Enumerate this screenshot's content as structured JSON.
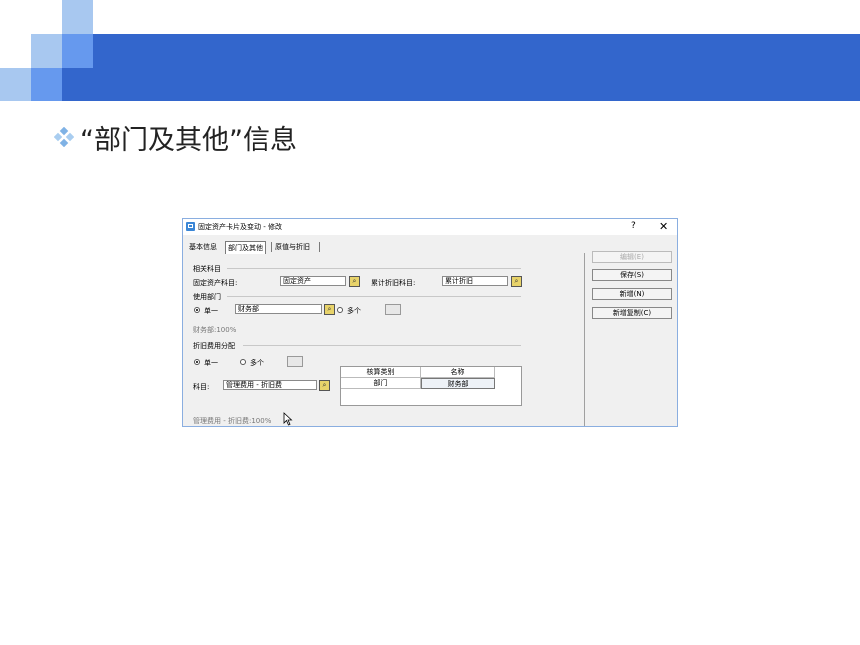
{
  "slide": {
    "title": "“部门及其他”信息",
    "accent_color": "#3366CC"
  },
  "dialog": {
    "title": "固定资产卡片及变动 - 修改",
    "help_glyph": "?",
    "close_glyph": "✕",
    "tabs": [
      {
        "label": "基本信息",
        "active": false
      },
      {
        "label": "部门及其他",
        "active": true
      },
      {
        "label": "原值与折旧",
        "active": false
      }
    ],
    "related_accounts": {
      "section": "相关科目",
      "asset_label": "固定资产科目:",
      "asset_value": "固定资产",
      "dep_label": "累计折旧科目:",
      "dep_value": "累计折旧"
    },
    "department": {
      "section": "使用部门",
      "single_label": "单一",
      "single_value": "财务部",
      "multi_label": "多个",
      "summary": "财务部:100%"
    },
    "allocation": {
      "section": "折旧费用分配",
      "single_label": "单一",
      "multi_label": "多个",
      "account_label": "科目:",
      "account_value": "管理费用 - 折旧费",
      "summary": "管理费用 - 折旧费:100%",
      "grid_headers": [
        "核算类别",
        "名称"
      ],
      "grid_rows": [
        [
          "部门",
          "财务部"
        ]
      ]
    },
    "buttons": {
      "edit": "编辑(E)",
      "save": "保存(S)",
      "add": "新增(N)",
      "add_copy": "新增复制(C)"
    }
  }
}
